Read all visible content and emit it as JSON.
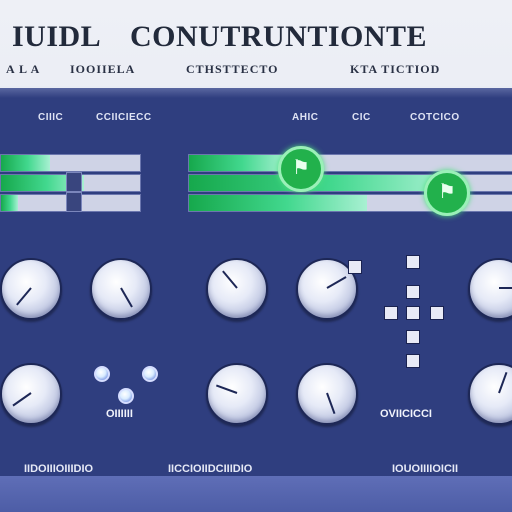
{
  "header": {
    "title_a": "IUIDL",
    "title_b": "CONUTRUNTIONTE",
    "subtitle_1": "A L A",
    "subtitle_2": "IOOIIELA",
    "subtitle_3": "CTHSTTECTO",
    "subtitle_4": "KTA TICTIOD"
  },
  "menu": {
    "item_1": "CIIIC",
    "item_2": "CCIICIECC",
    "item_3": "AHIC",
    "item_4": "CIC",
    "item_5": "COTCICO"
  },
  "controls": {
    "bar_levels": [
      0.35,
      0.6,
      0.12,
      0.3,
      0.8,
      0.55
    ],
    "knob_label_left": "OIIIIII",
    "knob_label_right": "OVIICICCI"
  },
  "bottom": {
    "label_1": "IIDOIIIOIIIDIO",
    "label_2": "IICCIOIIDCIIIDIO",
    "label_3": "IOUOIIIIOICII"
  }
}
